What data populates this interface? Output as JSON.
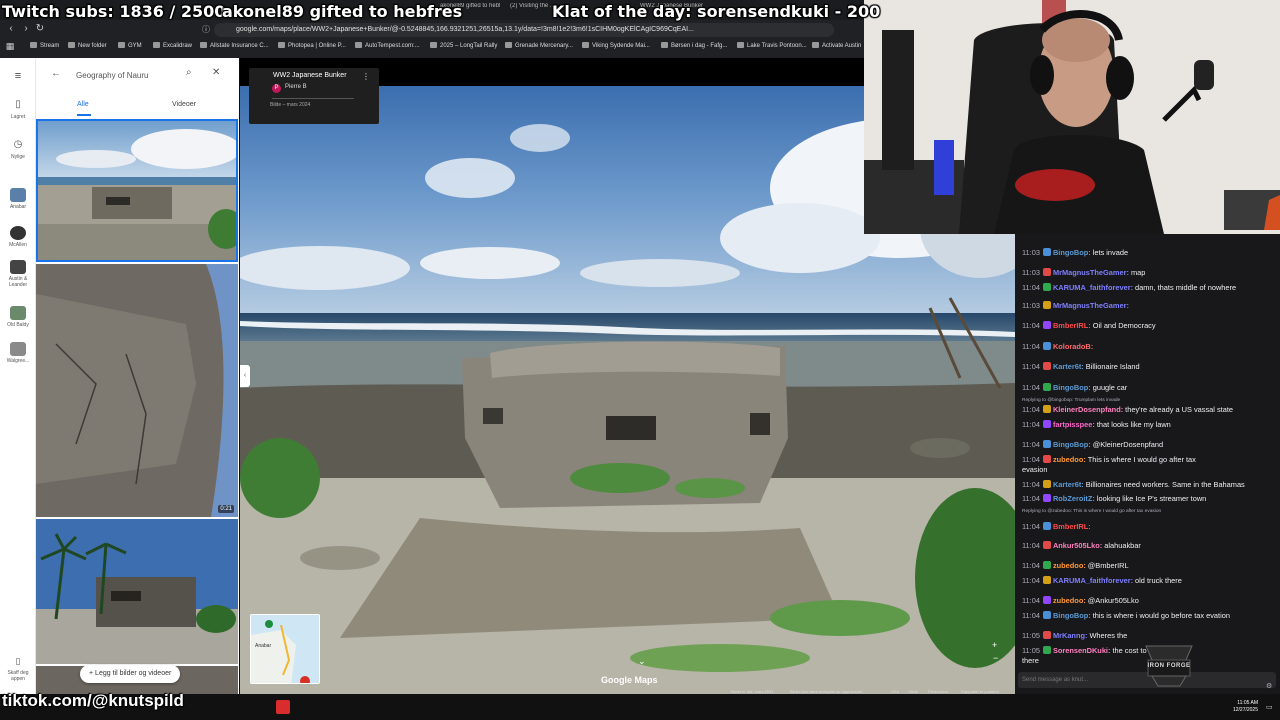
{
  "overlay": {
    "subs": "Twitch subs: 1836 / 2500",
    "gift": "akonel89 gifted to hebfres",
    "klat": "Klat of the day: sorensendkuki - 200",
    "tiktok": "tiktok.com/@knutspild"
  },
  "browser": {
    "tabs": [
      "akonel89 gifted to hebfres... t'es chez moi",
      "(2) Visiting the ...",
      "WW2 Japanese Bunker"
    ],
    "url": "google.com/maps/place/WW2+Japanese+Bunker/@-0.5248845,166.9321251,26515a,13.1y/data=!3m8!1e2!3m6!1sCIHM0ogKElCAgIC969CqEAI...",
    "bookmarks": [
      "Stream",
      "New folder",
      "GYM",
      "Excalidraw",
      "Allstate Insurance C...",
      "Photopea | Online P...",
      "AutoTempest.com:...",
      "2025 – LongTail Rally",
      "Grenade Mercenary...",
      "Viking Sydende Mai...",
      "Børsen i dag - Fafg...",
      "Lake Travis Pontoon...",
      "Activate Austin"
    ]
  },
  "rail": {
    "items": [
      {
        "label": "Lagret",
        "icon": "bookmark-icon"
      },
      {
        "label": "Nylige",
        "icon": "history-icon"
      },
      {
        "label": "Anabar",
        "icon": "place-thumb"
      },
      {
        "label": "McAllen",
        "icon": "place-thumb"
      },
      {
        "label": "Austin & Leander",
        "icon": "place-thumb"
      },
      {
        "label": "Old Baldy",
        "icon": "place-thumb"
      },
      {
        "label": "Walgree...",
        "icon": "place-thumb"
      },
      {
        "label": "Skaff deg appen",
        "icon": "phone-icon"
      }
    ]
  },
  "panel": {
    "search": "Geography of Nauru",
    "tabs": [
      "Alle",
      "Videoer"
    ],
    "video_duration": "0:21",
    "add_photos": "Legg til bilder og videoer"
  },
  "photo": {
    "title": "WW2 Japanese Bunker",
    "author": "Pierre B",
    "author_initial": "P",
    "date": "Bilde – mars 2024",
    "brand": "Google Maps",
    "footer": [
      "Bildet er tatt: mars 2024",
      "Bilder kan være beskyttet av opphavsrett.",
      "USA",
      "Vilkår",
      "Personvern",
      "Rapporter et problem"
    ],
    "minimap_label": "Anabar"
  },
  "chat": {
    "messages": [
      {
        "time": "11:03",
        "user": "BingoBop:",
        "text": "lets invade",
        "color": "#5b9bd5"
      },
      {
        "time": "11:03",
        "user": "MrMagnusTheGamer:",
        "text": "map",
        "color": "#7f7fff"
      },
      {
        "time": "11:04",
        "user": "KARUMA_faithforever:",
        "text": "damn, thats middle of nowhere",
        "color": "#7f7fff"
      },
      {
        "time": "11:03",
        "user": "MrMagnusTheGamer:",
        "text": "",
        "color": "#7f7fff"
      },
      {
        "time": "11:04",
        "user": "BmberIRL:",
        "text": "Oil and Democracy",
        "color": "#ff4a4a"
      },
      {
        "time": "11:04",
        "user": "KoloradoB:",
        "text": "",
        "color": "#ff6a6a"
      },
      {
        "time": "11:04",
        "user": "Karter6t:",
        "text": "Billionaire Island",
        "color": "#5b9bd5"
      },
      {
        "time": "11:04",
        "user": "BingoBop:",
        "text": "guugle car",
        "color": "#5b9bd5"
      },
      {
        "time": "11:04",
        "user": "KleinerDosenpfand:",
        "text": "they're already a US vassal state",
        "color": "#ff7fbf"
      },
      {
        "time": "11:04",
        "user": "fartpisspee:",
        "text": "that looks like my lawn",
        "color": "#ff66cc"
      },
      {
        "time": "11:04",
        "user": "BingoBop:",
        "text": "@KleinerDosenpfand",
        "color": "#5b9bd5"
      },
      {
        "time": "11:04",
        "user": "zubedoo:",
        "text": "This is where I would go after tax",
        "color": "#ff9933"
      },
      {
        "time": "",
        "user": "",
        "text": "evasion",
        "color": "#efeff1"
      },
      {
        "time": "11:04",
        "user": "Karter6t:",
        "text": "Billionaires need workers. Same in the Bahamas",
        "color": "#5b9bd5"
      },
      {
        "time": "11:04",
        "user": "RobZeroitZ:",
        "text": "looking like Ice P's streamer town",
        "color": "#5b9bd5"
      },
      {
        "time": "11:04",
        "user": "BmberIRL:",
        "text": "",
        "color": "#ff4a4a"
      },
      {
        "time": "11:04",
        "user": "Ankur505Lko:",
        "text": "alahuakbar",
        "color": "#ff7fbf"
      },
      {
        "time": "11:04",
        "user": "zubedoo:",
        "text": "@BmberIRL",
        "color": "#ff9933"
      },
      {
        "time": "11:04",
        "user": "KARUMA_faithforever:",
        "text": "old truck there",
        "color": "#7f7fff"
      },
      {
        "time": "11:04",
        "user": "zubedoo:",
        "text": "@Ankur505Lko",
        "color": "#ff9933"
      },
      {
        "time": "11:04",
        "user": "BingoBop:",
        "text": "this is where i would go before tax evation",
        "color": "#5b9bd5"
      },
      {
        "time": "11:05",
        "user": "MrKanng:",
        "text": "Wheres the",
        "color": "#7f7fff"
      },
      {
        "time": "11:05",
        "user": "SorensenDKuki:",
        "text": "the cost to import stuff",
        "color": "#ff7fbf"
      },
      {
        "time": "",
        "user": "",
        "text": "there",
        "color": "#efeff1"
      }
    ],
    "replies": [
      "Replying to @bingobop: Trumplam lets invade",
      "Replying to @zubedoo: This is where I would go after tax evasion"
    ],
    "input_placeholder": "Send message as knut..."
  },
  "clock": {
    "time": "11:05 AM",
    "date": "12/27/2025"
  },
  "iron_logo": "IRON FORGE"
}
